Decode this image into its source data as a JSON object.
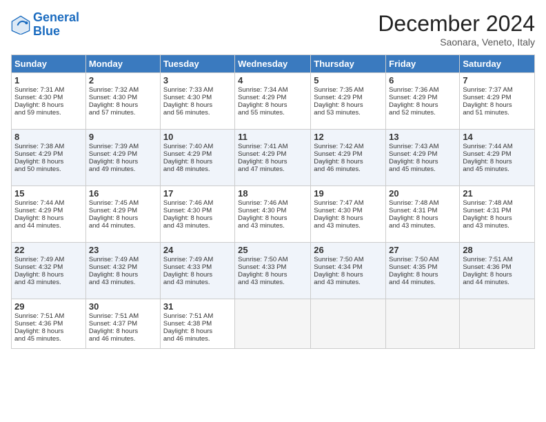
{
  "logo": {
    "line1": "General",
    "line2": "Blue"
  },
  "header": {
    "month": "December 2024",
    "location": "Saonara, Veneto, Italy"
  },
  "weekdays": [
    "Sunday",
    "Monday",
    "Tuesday",
    "Wednesday",
    "Thursday",
    "Friday",
    "Saturday"
  ],
  "weeks": [
    [
      {
        "day": 1,
        "sunrise": "7:31 AM",
        "sunset": "4:30 PM",
        "daylight": "8 hours and 59 minutes."
      },
      {
        "day": 2,
        "sunrise": "7:32 AM",
        "sunset": "4:30 PM",
        "daylight": "8 hours and 57 minutes."
      },
      {
        "day": 3,
        "sunrise": "7:33 AM",
        "sunset": "4:30 PM",
        "daylight": "8 hours and 56 minutes."
      },
      {
        "day": 4,
        "sunrise": "7:34 AM",
        "sunset": "4:29 PM",
        "daylight": "8 hours and 55 minutes."
      },
      {
        "day": 5,
        "sunrise": "7:35 AM",
        "sunset": "4:29 PM",
        "daylight": "8 hours and 53 minutes."
      },
      {
        "day": 6,
        "sunrise": "7:36 AM",
        "sunset": "4:29 PM",
        "daylight": "8 hours and 52 minutes."
      },
      {
        "day": 7,
        "sunrise": "7:37 AM",
        "sunset": "4:29 PM",
        "daylight": "8 hours and 51 minutes."
      }
    ],
    [
      {
        "day": 8,
        "sunrise": "7:38 AM",
        "sunset": "4:29 PM",
        "daylight": "8 hours and 50 minutes."
      },
      {
        "day": 9,
        "sunrise": "7:39 AM",
        "sunset": "4:29 PM",
        "daylight": "8 hours and 49 minutes."
      },
      {
        "day": 10,
        "sunrise": "7:40 AM",
        "sunset": "4:29 PM",
        "daylight": "8 hours and 48 minutes."
      },
      {
        "day": 11,
        "sunrise": "7:41 AM",
        "sunset": "4:29 PM",
        "daylight": "8 hours and 47 minutes."
      },
      {
        "day": 12,
        "sunrise": "7:42 AM",
        "sunset": "4:29 PM",
        "daylight": "8 hours and 46 minutes."
      },
      {
        "day": 13,
        "sunrise": "7:43 AM",
        "sunset": "4:29 PM",
        "daylight": "8 hours and 45 minutes."
      },
      {
        "day": 14,
        "sunrise": "7:44 AM",
        "sunset": "4:29 PM",
        "daylight": "8 hours and 45 minutes."
      }
    ],
    [
      {
        "day": 15,
        "sunrise": "7:44 AM",
        "sunset": "4:29 PM",
        "daylight": "8 hours and 44 minutes."
      },
      {
        "day": 16,
        "sunrise": "7:45 AM",
        "sunset": "4:29 PM",
        "daylight": "8 hours and 44 minutes."
      },
      {
        "day": 17,
        "sunrise": "7:46 AM",
        "sunset": "4:30 PM",
        "daylight": "8 hours and 43 minutes."
      },
      {
        "day": 18,
        "sunrise": "7:46 AM",
        "sunset": "4:30 PM",
        "daylight": "8 hours and 43 minutes."
      },
      {
        "day": 19,
        "sunrise": "7:47 AM",
        "sunset": "4:30 PM",
        "daylight": "8 hours and 43 minutes."
      },
      {
        "day": 20,
        "sunrise": "7:48 AM",
        "sunset": "4:31 PM",
        "daylight": "8 hours and 43 minutes."
      },
      {
        "day": 21,
        "sunrise": "7:48 AM",
        "sunset": "4:31 PM",
        "daylight": "8 hours and 43 minutes."
      }
    ],
    [
      {
        "day": 22,
        "sunrise": "7:49 AM",
        "sunset": "4:32 PM",
        "daylight": "8 hours and 43 minutes."
      },
      {
        "day": 23,
        "sunrise": "7:49 AM",
        "sunset": "4:32 PM",
        "daylight": "8 hours and 43 minutes."
      },
      {
        "day": 24,
        "sunrise": "7:49 AM",
        "sunset": "4:33 PM",
        "daylight": "8 hours and 43 minutes."
      },
      {
        "day": 25,
        "sunrise": "7:50 AM",
        "sunset": "4:33 PM",
        "daylight": "8 hours and 43 minutes."
      },
      {
        "day": 26,
        "sunrise": "7:50 AM",
        "sunset": "4:34 PM",
        "daylight": "8 hours and 43 minutes."
      },
      {
        "day": 27,
        "sunrise": "7:50 AM",
        "sunset": "4:35 PM",
        "daylight": "8 hours and 44 minutes."
      },
      {
        "day": 28,
        "sunrise": "7:51 AM",
        "sunset": "4:36 PM",
        "daylight": "8 hours and 44 minutes."
      }
    ],
    [
      {
        "day": 29,
        "sunrise": "7:51 AM",
        "sunset": "4:36 PM",
        "daylight": "8 hours and 45 minutes."
      },
      {
        "day": 30,
        "sunrise": "7:51 AM",
        "sunset": "4:37 PM",
        "daylight": "8 hours and 46 minutes."
      },
      {
        "day": 31,
        "sunrise": "7:51 AM",
        "sunset": "4:38 PM",
        "daylight": "8 hours and 46 minutes."
      },
      null,
      null,
      null,
      null
    ]
  ]
}
